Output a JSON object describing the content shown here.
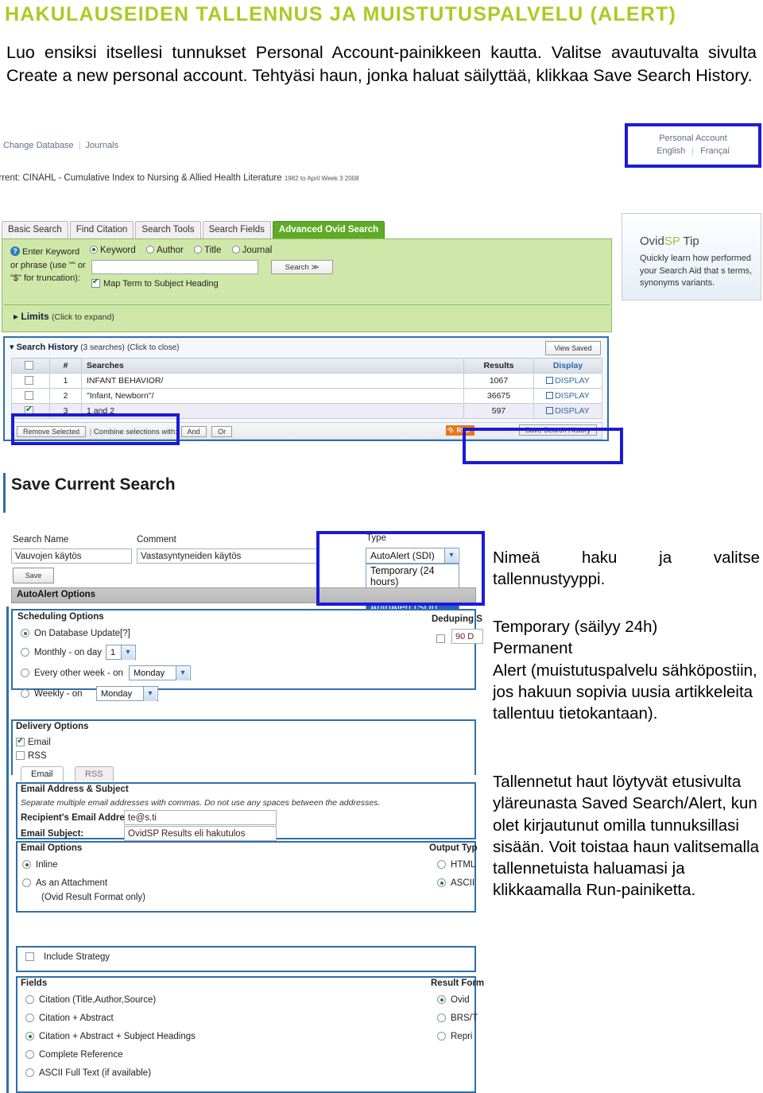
{
  "doc": {
    "title": "HAKULAUSEIDEN TALLENNUS JA MUISTUTUSPALVELU (ALERT)",
    "title_color": "#a8cc22",
    "intro": "Luo ensiksi itsellesi tunnukset Personal Account-painikkeen kautta. Valitse avautuvalta sivulta Create a new personal account. Tehtyäsi haun, jonka haluat säilyttää, klikkaa Save Search History."
  },
  "screenshot": {
    "topnav": {
      "change_database": "Change Database",
      "journals": "Journals"
    },
    "account_box": {
      "title": "Personal Account",
      "lang_en": "English",
      "lang_fr": "Françai",
      "highlight_color": "#1b1bd6"
    },
    "database_line": {
      "prefix": "urrent:",
      "name": "CINAHL - Cumulative Index to Nursing & Allied Health Literature",
      "coverage": "1982 to April Week 3 2008"
    },
    "tabs": [
      {
        "label": "Basic Search",
        "active": false
      },
      {
        "label": "Find Citation",
        "active": false
      },
      {
        "label": "Search Tools",
        "active": false
      },
      {
        "label": "Search Fields",
        "active": false
      },
      {
        "label": "Advanced Ovid Search",
        "active": true
      }
    ],
    "search_panel": {
      "prompt": "Enter Keyword or phrase (use \"\" or \"$\" for truncation):",
      "radios": [
        {
          "label": "Keyword",
          "selected": true
        },
        {
          "label": "Author",
          "selected": false
        },
        {
          "label": "Title",
          "selected": false
        },
        {
          "label": "Journal",
          "selected": false
        }
      ],
      "query_value": "",
      "search_button": "Search ≫",
      "map_term_label": "Map Term to Subject Heading",
      "map_term_checked": true,
      "limits_label": "Limits",
      "limits_hint": "(Click to expand)"
    },
    "tip_box": {
      "title_a": "Ovid",
      "title_b": "SP",
      "title_c": " Tip",
      "body": "Quickly learn how performed your Search Aid that s terms, synonyms variants."
    },
    "search_history": {
      "heading": "Search History",
      "count": "(3 searches)",
      "toggle": "(Click to close)",
      "view_saved": "View Saved",
      "columns": [
        "",
        "#",
        "Searches",
        "Results",
        "Display"
      ],
      "rows": [
        {
          "checked": false,
          "num": "1",
          "search": "INFANT BEHAVIOR/",
          "results": "1067",
          "display": "DISPLAY"
        },
        {
          "checked": false,
          "num": "2",
          "search": "\"Infant, Newborn\"/",
          "results": "36675",
          "display": "DISPLAY"
        },
        {
          "checked": true,
          "num": "3",
          "search": "1 and 2",
          "results": "597",
          "display": "DISPLAY"
        }
      ],
      "footer": {
        "remove_selected": "Remove Selected",
        "combine_label": "Combine selections with:",
        "and_button": "And",
        "or_button": "Or",
        "rss_button": "RSS",
        "save_button": "Save Search History"
      }
    },
    "save_current_search": {
      "title": "Save Current Search",
      "labels": {
        "search_name": "Search Name",
        "comment": "Comment",
        "type": "Type"
      },
      "search_name_value": "Vauvojen käytös",
      "comment_value": "Vastasyntyneiden käytös",
      "type_selected": "AutoAlert (SDI)",
      "type_options": [
        "Temporary (24 hours)",
        "Permanent",
        "AutoAlert (SDI)"
      ],
      "save_button": "Save",
      "autoalert_options_header": "AutoAlert Options"
    },
    "scheduling": {
      "header": "Scheduling Options",
      "options": [
        {
          "label": "On Database Update[?]",
          "selected": true
        },
        {
          "label": "Monthly - on day",
          "selected": false,
          "select_value": "1"
        },
        {
          "label": "Every other week - on",
          "selected": false,
          "select_value": "Monday"
        },
        {
          "label": "Weekly - on",
          "selected": false,
          "select_value": "Monday"
        }
      ],
      "dedup_header": "Deduping S",
      "dedup_checked": false,
      "dedup_value": "90 D"
    },
    "delivery": {
      "header": "Delivery Options",
      "email_label": "Email",
      "email_checked": true,
      "rss_label": "RSS",
      "rss_checked": false,
      "tabs": [
        {
          "label": "Email",
          "active": true
        },
        {
          "label": "RSS",
          "active": false
        }
      ]
    },
    "email_section": {
      "header": "Email Address & Subject",
      "hint": "Separate multiple email addresses with commas. Do not use any spaces between the addresses.",
      "recipient_label": "Recipient's Email Address:",
      "recipient_value": "te@s.ti",
      "subject_label": "Email Subject:",
      "subject_value": "OvidSP Results eli hakutulos"
    },
    "email_options": {
      "header": "Email Options",
      "options": [
        {
          "label": "Inline",
          "selected": true
        },
        {
          "label": "As an Attachment",
          "selected": false
        },
        {
          "label": "(Ovid Result Format only)",
          "selected": null
        }
      ],
      "output_type_header": "Output Typ",
      "output_types": [
        {
          "label": "HTML",
          "selected": false
        },
        {
          "label": "ASCII",
          "selected": true
        }
      ]
    },
    "include_strategy": {
      "label": "Include Strategy",
      "checked": false
    },
    "fields": {
      "header": "Fields",
      "options": [
        {
          "label": "Citation (Title,Author,Source)",
          "selected": false
        },
        {
          "label": "Citation + Abstract",
          "selected": false
        },
        {
          "label": "Citation + Abstract + Subject Headings",
          "selected": true
        },
        {
          "label": "Complete Reference",
          "selected": false
        },
        {
          "label": "ASCII Full Text (if available)",
          "selected": false
        }
      ],
      "result_format_header": "Result Form",
      "result_formats": [
        {
          "label": "Ovid",
          "selected": true
        },
        {
          "label": "BRS/T",
          "selected": false
        },
        {
          "label": "Repri",
          "selected": false
        }
      ]
    }
  },
  "annotations": {
    "note1": "Nimeä haku ja valitse tallennustyyppi.",
    "note2": "Temporary (säilyy 24h)\nPermanent\nAlert (muistutuspalvelu sähköpostiin, jos hakuun sopivia uusia artikkeleita tallentuu tietokantaan).",
    "note3": "Tallennetut haut löytyvät etusivulta yläreunasta Saved Search/Alert, kun olet kirjautunut omilla tunnuksillasi sisään. Voit toistaa haun valitsemalla tallennetuista haluamasi ja klikkaamalla Run-painiketta."
  }
}
